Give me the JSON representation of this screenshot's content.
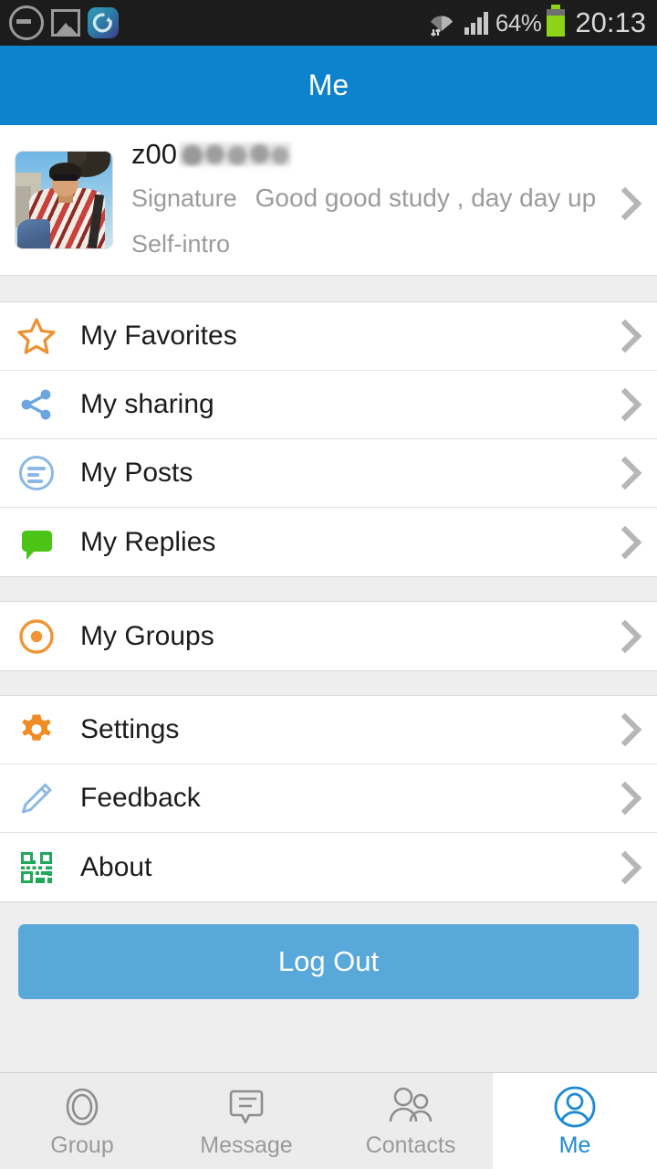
{
  "statusbar": {
    "notification_icons": [
      "do-not-disturb-icon",
      "photo-icon",
      "sync-app-icon"
    ],
    "wifi_icon": "wifi-with-data-arrows-icon",
    "signal_icon": "cellular-signal-icon",
    "battery_percent": "64%",
    "battery_icon": "battery-icon",
    "time": "20:13"
  },
  "header": {
    "title": "Me"
  },
  "profile": {
    "avatar_alt": "user-avatar-photo",
    "username": "z00",
    "username_redacted": true,
    "signature_label": "Signature",
    "signature_value": "Good good study , day day up",
    "self_intro_label": "Self-intro",
    "self_intro_value": "",
    "chevron": "chevron-right-icon"
  },
  "sections": [
    {
      "items": [
        {
          "label": "My Favorites",
          "icon": "star-icon",
          "icon_color": "#ef8f2e"
        },
        {
          "label": "My sharing",
          "icon": "share-icon",
          "icon_color": "#6ba6e0"
        },
        {
          "label": "My Posts",
          "icon": "document-circle-icon",
          "icon_color": "#8cb8e4"
        },
        {
          "label": "My Replies",
          "icon": "speech-bubble-icon",
          "icon_color": "#4cc417"
        }
      ]
    },
    {
      "items": [
        {
          "label": "My Groups",
          "icon": "target-circle-icon",
          "icon_color": "#f09434"
        }
      ]
    },
    {
      "items": [
        {
          "label": "Settings",
          "icon": "gear-icon",
          "icon_color": "#f08c26"
        },
        {
          "label": "Feedback",
          "icon": "pencil-icon",
          "icon_color": "#8cb8e4"
        },
        {
          "label": "About",
          "icon": "qr-code-icon",
          "icon_color": "#21a95a"
        }
      ]
    }
  ],
  "logout": {
    "label": "Log Out",
    "color": "#58a9da"
  },
  "tabbar": {
    "active_index": 3,
    "active_color": "#1c8ad4",
    "inactive_color": "#9a9a9a",
    "tabs": [
      {
        "label": "Group",
        "icon": "group-ring-icon"
      },
      {
        "label": "Message",
        "icon": "message-bubble-icon"
      },
      {
        "label": "Contacts",
        "icon": "contacts-people-icon"
      },
      {
        "label": "Me",
        "icon": "person-circle-icon"
      }
    ]
  }
}
